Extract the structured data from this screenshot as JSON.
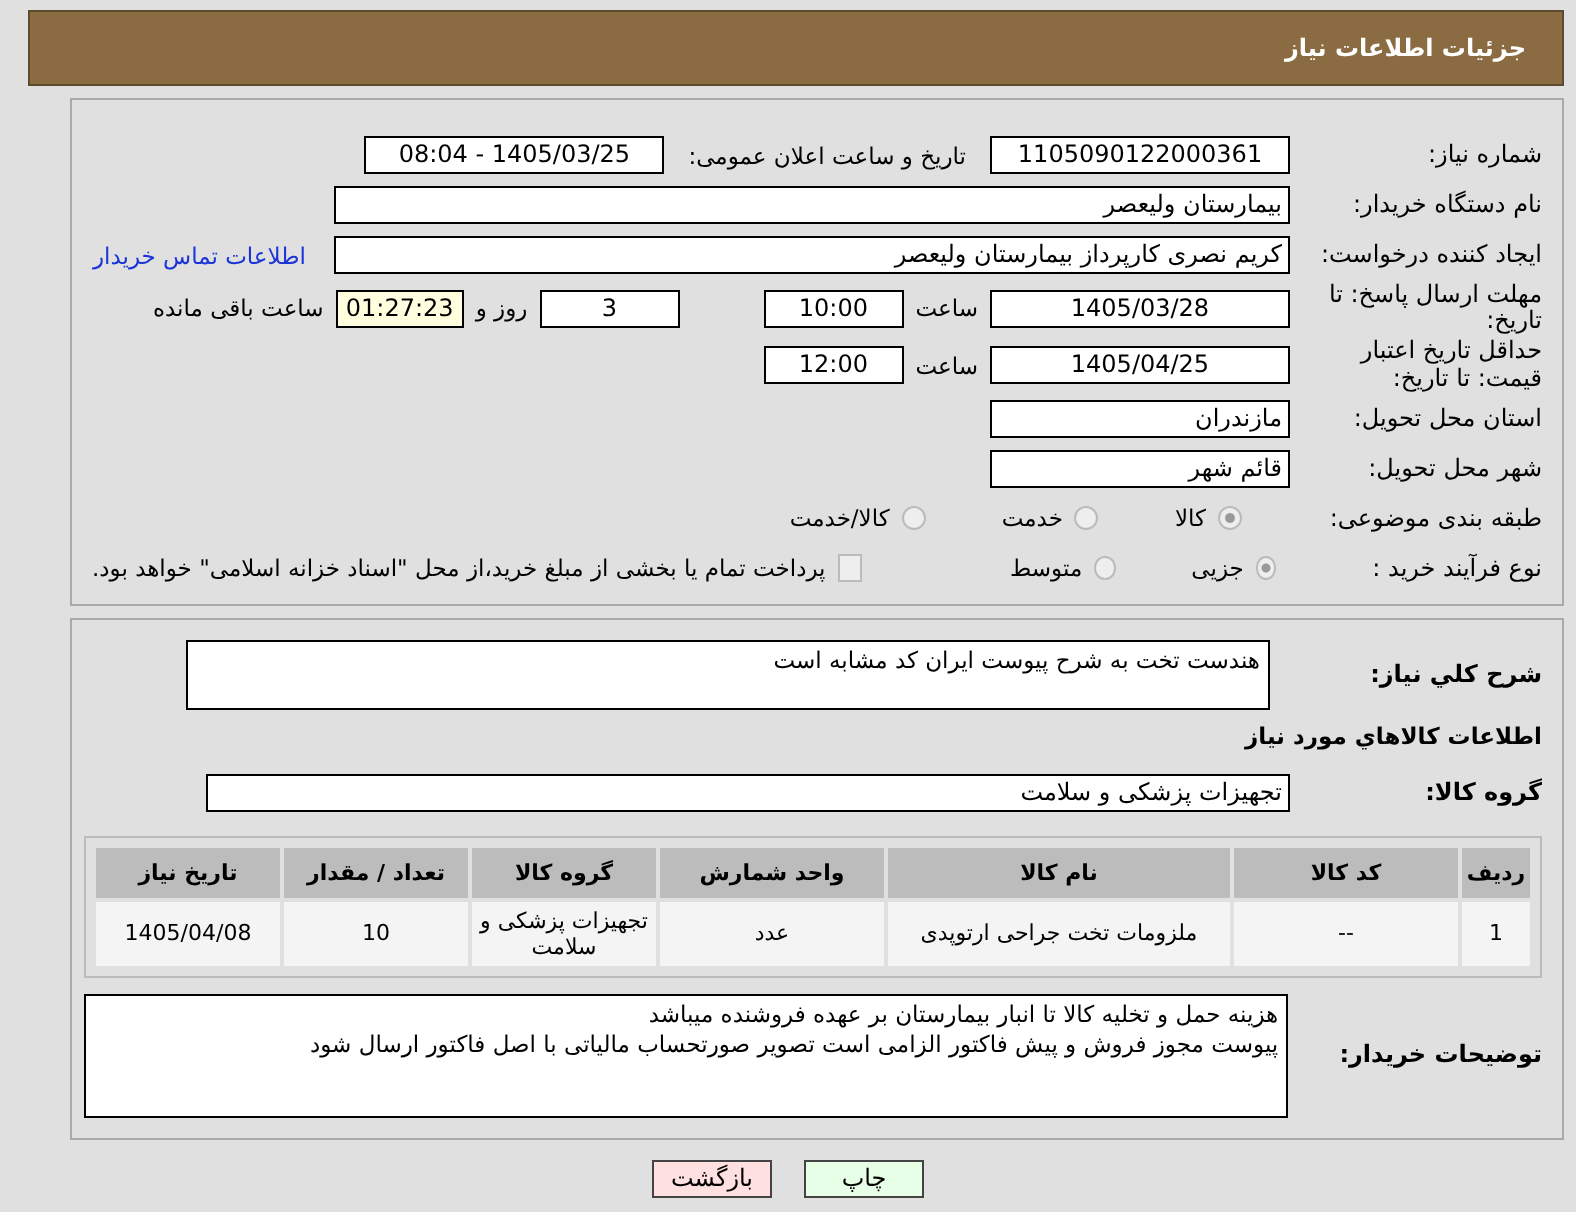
{
  "header": {
    "title": "جزئیات اطلاعات نیاز"
  },
  "need_number": {
    "label": "شماره نیاز:",
    "value": "1105090122000361"
  },
  "announce": {
    "label": "تاریخ و ساعت اعلان عمومی:",
    "value": "1405/03/25 - 08:04"
  },
  "buyer_org": {
    "label": "نام دستگاه خریدار:",
    "value": "بیمارستان ولیعصر"
  },
  "requester": {
    "label": "ایجاد کننده درخواست:",
    "value": "کریم نصری کارپرداز بیمارستان ولیعصر",
    "link": "اطلاعات تماس خریدار"
  },
  "deadline": {
    "label": "مهلت ارسال پاسخ: تا تاریخ:",
    "date": "1405/03/28",
    "time_label": "ساعت",
    "time": "10:00",
    "days": "3",
    "days_label": "روز و",
    "remaining": "01:27:23",
    "remaining_label": "ساعت باقی مانده"
  },
  "validity": {
    "label": "حداقل تاریخ اعتبار قیمت: تا تاریخ:",
    "date": "1405/04/25",
    "time_label": "ساعت",
    "time": "12:00"
  },
  "province": {
    "label": "استان محل تحویل:",
    "value": "مازندران"
  },
  "city": {
    "label": "شهر محل تحویل:",
    "value": "قائم شهر"
  },
  "category": {
    "label": "طبقه بندی موضوعی:",
    "options": [
      {
        "label": "کالا",
        "selected": true
      },
      {
        "label": "خدمت",
        "selected": false
      },
      {
        "label": "کالا/خدمت",
        "selected": false
      }
    ]
  },
  "purchase_type": {
    "label": "نوع فرآیند خرید :",
    "options": [
      {
        "label": "جزیی",
        "selected": true
      },
      {
        "label": "متوسط",
        "selected": false
      }
    ],
    "payment": {
      "label": "پرداخت تمام یا بخشی از مبلغ خرید،از محل \"اسناد خزانه اسلامی\" خواهد بود.",
      "checked": false
    }
  },
  "description": {
    "label": "شرح کلي نياز:",
    "value": "هندست تخت به شرح پیوست   ایران کد مشابه است"
  },
  "goods_title": "اطلاعات کالاهاي مورد نياز",
  "goods_group": {
    "label": "گروه کالا:",
    "value": "تجهیزات پزشکی و سلامت"
  },
  "table": {
    "columns": [
      "ردیف",
      "کد کالا",
      "نام کالا",
      "واحد شمارش",
      "گروه کالا",
      "تعداد / مقدار",
      "تاریخ نیاز"
    ],
    "rows": [
      [
        "1",
        "--",
        "ملزومات تخت جراحی ارتوپدی",
        "عدد",
        "تجهیزات پزشکی و سلامت",
        "10",
        "1405/04/08"
      ]
    ]
  },
  "buyer_notes": {
    "label": "توضیحات خریدار:",
    "lines": [
      "هزینه حمل و تخلیه کالا تا انبار بیمارستان بر عهده فروشنده میباشد",
      "پیوست مجوز فروش و پیش فاکتور الزامی است  تصویر صورتحساب مالیاتی با اصل فاکتور ارسال شود"
    ]
  },
  "buttons": [
    {
      "label": "چاپ",
      "kind": "print"
    },
    {
      "label": "بازگشت",
      "kind": "back"
    }
  ]
}
